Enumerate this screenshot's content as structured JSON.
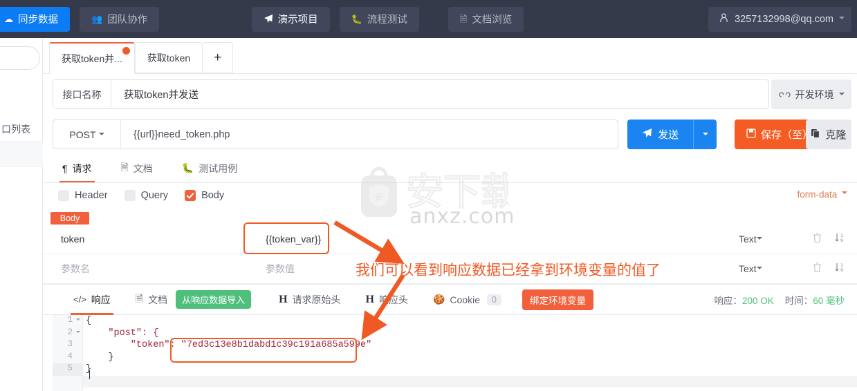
{
  "topbar": {
    "sync_label": "同步数据",
    "sync_icon": "cloud-sync-icon",
    "team_label": "团队协作",
    "team_icon": "team-icon",
    "demo_label": "演示项目",
    "demo_icon": "send-plane-icon",
    "flow_label": "流程测试",
    "flow_icon": "bug-icon",
    "doc_label": "文档浏览",
    "doc_icon": "document-icon",
    "user_email": "3257132998@qq.com",
    "user_icon": "user-icon"
  },
  "sidebar": {
    "list_label": "口列表",
    "search_placeholder": ""
  },
  "tabs": [
    {
      "label": "获取token并...",
      "active": true,
      "dirty": true
    },
    {
      "label": "获取token",
      "active": false,
      "dirty": false
    }
  ],
  "tab_add_label": "+",
  "interface": {
    "name_label": "接口名称",
    "name_value": "获取token并发送",
    "env_label": "开发环境",
    "env_icon": "link-icon"
  },
  "request": {
    "method": "POST",
    "url": "{{url}}need_token.php",
    "send_label": "发送",
    "send_icon": "send-plane-icon",
    "save_label": "保存（至）",
    "save_icon": "floppy-icon",
    "clone_label": "克隆",
    "clone_icon": "copy-icon"
  },
  "request_tabs": [
    {
      "label": "请求",
      "icon": "paragraph-icon",
      "active": true
    },
    {
      "label": "文档",
      "icon": "document-icon",
      "active": false
    },
    {
      "label": "测试用例",
      "icon": "bug-icon",
      "active": false
    }
  ],
  "param_types": [
    {
      "label": "Header",
      "checked": false
    },
    {
      "label": "Query",
      "checked": false
    },
    {
      "label": "Body",
      "checked": true
    }
  ],
  "body_format": "form-data",
  "body_badge": "Body",
  "param_table": {
    "rows": [
      {
        "name": "token",
        "value": "{{token_var}}",
        "type": "Text",
        "is_placeholder": false
      },
      {
        "name": "参数名",
        "value": "参数值",
        "type": "Text",
        "is_placeholder": true
      }
    ],
    "delete_icon": "trash-icon",
    "sort_icon": "sort-numeric-icon"
  },
  "response_tabs": [
    {
      "label": "响应",
      "icon": "code-icon",
      "active": true
    },
    {
      "label": "文档",
      "icon": "document-icon",
      "active": false
    },
    {
      "label": "请求原始头",
      "icon": "H",
      "active": false
    },
    {
      "label": "响应头",
      "icon": "H",
      "active": false
    },
    {
      "label": "Cookie",
      "icon": "cookie-icon",
      "active": false,
      "count": "0"
    }
  ],
  "import_button": "从响应数据导入",
  "bind_env_button": "绑定环境变量",
  "status": {
    "resp_label": "响应：",
    "resp_value": "200 OK",
    "time_label": "时间：",
    "time_value": "60 毫秒"
  },
  "editor": {
    "lines": [
      "1",
      "2",
      "3",
      "4",
      "5"
    ],
    "code_line1": "{",
    "code_line2": "    \"post\": {",
    "code_line3_key": "        \"token\": ",
    "code_line3_val": "\"7ed3c13e8b1dabd1c39c191a685a599e\"",
    "code_line4": "    }",
    "code_line5": "}"
  },
  "annotation": {
    "text": "我们可以看到响应数据已经拿到环境变量的值了",
    "color": "#ef5a24"
  },
  "watermark": {
    "text": "anxz.com",
    "glyph": "安"
  },
  "colors": {
    "accent_orange": "#f2603b",
    "accent_blue": "#1a85f0",
    "green": "#4ec07c",
    "topbar_bg": "#353a4b"
  }
}
